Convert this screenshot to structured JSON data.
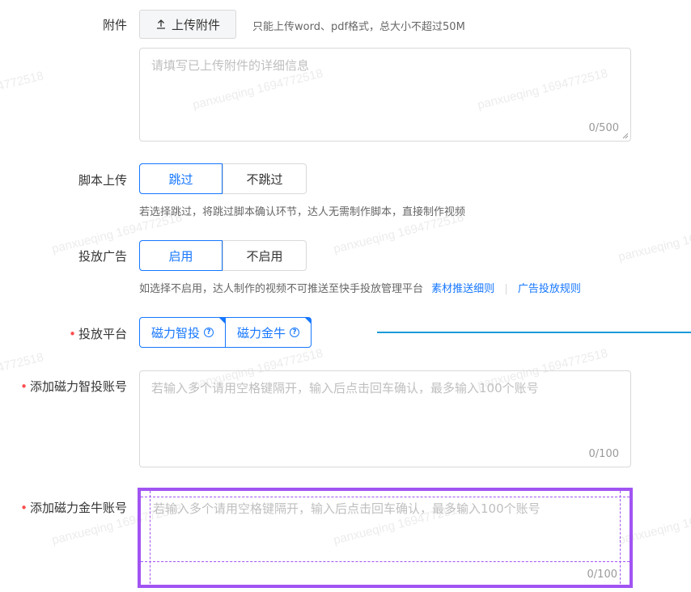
{
  "attachment": {
    "label": "附件",
    "upload_button": "上传附件",
    "hint": "只能上传word、pdf格式，总大小不超过50M",
    "placeholder": "请填写已上传附件的详细信息",
    "count": "0/500"
  },
  "script_upload": {
    "label": "脚本上传",
    "options": [
      "跳过",
      "不跳过"
    ],
    "selected": "跳过",
    "hint": "若选择跳过，将跳过脚本确认环节，达人无需制作脚本，直接制作视频"
  },
  "ad_delivery": {
    "label": "投放广告",
    "options": [
      "启用",
      "不启用"
    ],
    "selected": "启用",
    "hint": "如选择不启用，达人制作的视频不可推送至快手投放管理平台",
    "link1": "素材推送细则",
    "link2": "广告投放规则"
  },
  "platform": {
    "label": "投放平台",
    "options": [
      "磁力智投",
      "磁力金牛"
    ]
  },
  "zhitou_account": {
    "label": "添加磁力智投账号",
    "placeholder": "若输入多个请用空格键隔开，输入后点击回车确认，最多输入100个账号",
    "count": "0/100"
  },
  "jinniu_account": {
    "label": "添加磁力金牛账号",
    "placeholder": "若输入多个请用空格键隔开，输入后点击回车确认，最多输入100个账号",
    "count": "0/100"
  },
  "watermark": {
    "text_a": "panxueqing 1694772518",
    "text_b": "4772518"
  },
  "colors": {
    "accent": "#1677ff",
    "required": "#ff4d4f",
    "highlight": "#a154f2",
    "connector": "#1c9bd8"
  }
}
